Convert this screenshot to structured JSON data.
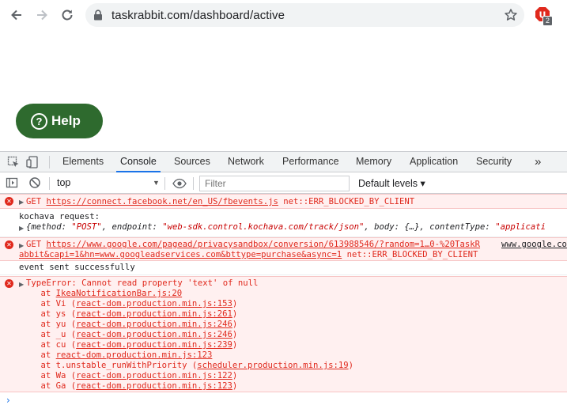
{
  "browser": {
    "url": "taskrabbit.com/dashboard/active",
    "extension_badge": "2"
  },
  "page": {
    "help_label": "Help",
    "help_q": "?"
  },
  "devtools": {
    "tabs": [
      "Elements",
      "Console",
      "Sources",
      "Network",
      "Performance",
      "Memory",
      "Application",
      "Security"
    ],
    "more": "»",
    "context": "top",
    "filter_placeholder": "Filter",
    "levels": "Default levels ▾"
  },
  "console": {
    "err1": {
      "prefix": "GET ",
      "url": "https://connect.facebook.net/en_US/fbevents.js",
      "status": " net::ERR_BLOCKED_BY_CLIENT"
    },
    "kochava": {
      "title": "kochava request:",
      "obj_a": "{method: ",
      "obj_b": "\"POST\"",
      "obj_c": ", endpoint: ",
      "obj_d": "\"web-sdk.control.kochava.com/track/json\"",
      "obj_e": ", body: {…}, contentType: ",
      "obj_f": "\"applicati"
    },
    "err2": {
      "prefix": "GET ",
      "url": "https://www.google.com/pagead/privacysandbox/conversion/613988546/?random=1…0-%20TaskR",
      "source": "www.google.co",
      "line2": "abbit&capi=1&hn=www.googleadservices.com&bttype=purchase&async=1",
      "status": " net::ERR_BLOCKED_BY_CLIENT"
    },
    "event_sent": "event sent successfully",
    "type_error": {
      "title": "TypeError: Cannot read property 'text' of null",
      "stack": [
        {
          "pre": "    at ",
          "fn": "",
          "src": "IkeaNotificationBar.js:20",
          "paren": false
        },
        {
          "pre": "    at ",
          "fn": "Vi (",
          "src": "react-dom.production.min.js:153",
          "paren": true
        },
        {
          "pre": "    at ",
          "fn": "ys (",
          "src": "react-dom.production.min.js:261",
          "paren": true
        },
        {
          "pre": "    at ",
          "fn": "yu (",
          "src": "react-dom.production.min.js:246",
          "paren": true
        },
        {
          "pre": "    at ",
          "fn": "_u (",
          "src": "react-dom.production.min.js:246",
          "paren": true
        },
        {
          "pre": "    at ",
          "fn": "cu (",
          "src": "react-dom.production.min.js:239",
          "paren": true
        },
        {
          "pre": "    at ",
          "fn": "",
          "src": "react-dom.production.min.js:123",
          "paren": false
        },
        {
          "pre": "    at ",
          "fn": "t.unstable_runWithPriority (",
          "src": "scheduler.production.min.js:19",
          "paren": true
        },
        {
          "pre": "    at ",
          "fn": "Wa (",
          "src": "react-dom.production.min.js:122",
          "paren": true
        },
        {
          "pre": "    at ",
          "fn": "Ga (",
          "src": "react-dom.production.min.js:123",
          "paren": true
        }
      ]
    },
    "prompt": "›"
  }
}
